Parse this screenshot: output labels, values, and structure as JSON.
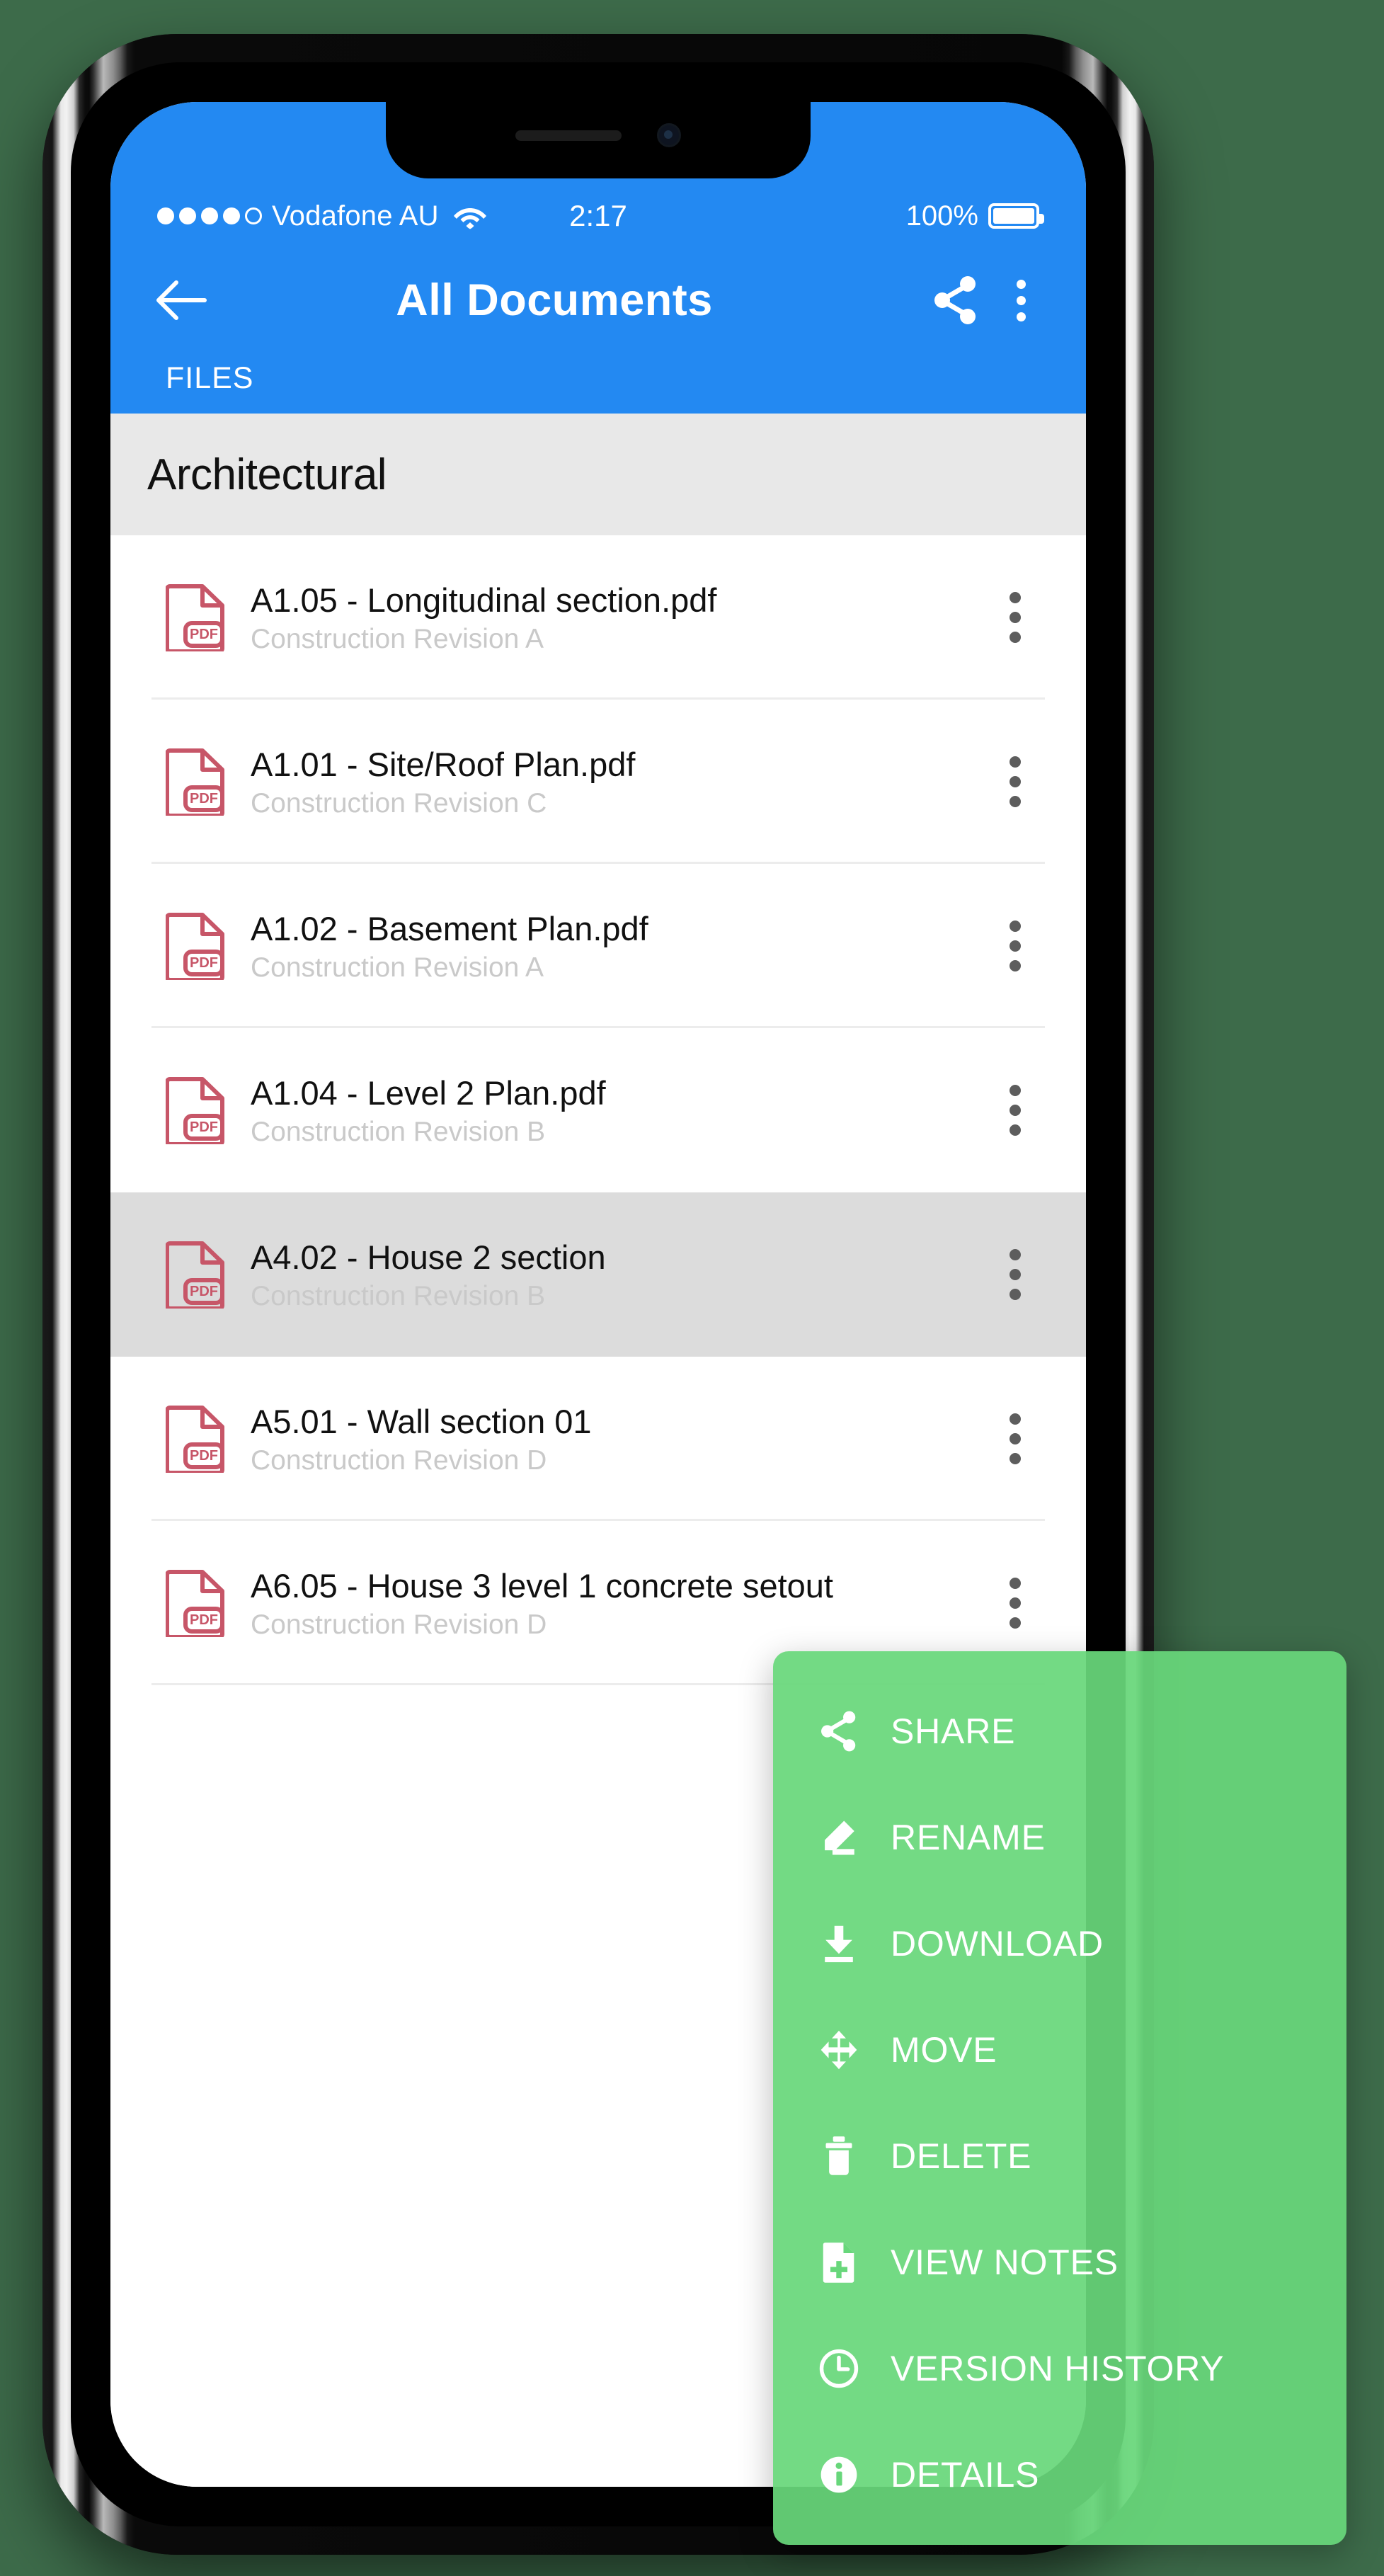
{
  "status_bar": {
    "signal_dots_filled": 4,
    "signal_dots_total": 5,
    "carrier": "Vodafone AU",
    "wifi_icon": "wifi-icon",
    "time": "2:17",
    "battery_percent": "100%",
    "battery_icon": "battery-full-icon"
  },
  "app_bar": {
    "back_icon": "back-arrow-icon",
    "title": "All Documents",
    "share_icon": "share-icon",
    "overflow_icon": "overflow-menu-icon",
    "background_color": "#2389f2"
  },
  "tabs": [
    {
      "label": "FILES",
      "active": true
    }
  ],
  "section": {
    "title": "Architectural",
    "background_color": "#e8e8e8"
  },
  "files": [
    {
      "name": "A1.05 - Longitudinal section.pdf",
      "revision": "Construction Revision A",
      "icon": "pdf-file-icon",
      "selected": false
    },
    {
      "name": "A1.01 - Site/Roof Plan.pdf",
      "revision": "Construction Revision C",
      "icon": "pdf-file-icon",
      "selected": false
    },
    {
      "name": "A1.02 - Basement Plan.pdf",
      "revision": "Construction Revision A",
      "icon": "pdf-file-icon",
      "selected": false
    },
    {
      "name": "A1.04 - Level 2 Plan.pdf",
      "revision": "Construction Revision B",
      "icon": "pdf-file-icon",
      "selected": false
    },
    {
      "name": "A4.02 - House 2 section",
      "revision": "Construction Revision B",
      "icon": "pdf-file-icon",
      "selected": true
    },
    {
      "name": "A5.01 - Wall section 01",
      "revision": "Construction Revision D",
      "icon": "pdf-file-icon",
      "selected": false
    },
    {
      "name": "A6.05 - House 3 level 1 concrete setout",
      "revision": "Construction Revision D",
      "icon": "pdf-file-icon",
      "selected": false
    }
  ],
  "context_menu": {
    "background_color": "#68d77b",
    "items": [
      {
        "label": "SHARE",
        "icon": "share-icon"
      },
      {
        "label": "RENAME",
        "icon": "pencil-icon"
      },
      {
        "label": "DOWNLOAD",
        "icon": "download-icon"
      },
      {
        "label": "MOVE",
        "icon": "move-arrows-icon"
      },
      {
        "label": "DELETE",
        "icon": "trash-icon"
      },
      {
        "label": "VIEW NOTES",
        "icon": "note-add-icon"
      },
      {
        "label": "VERSION HISTORY",
        "icon": "clock-icon"
      },
      {
        "label": "DETAILS",
        "icon": "info-icon"
      }
    ]
  },
  "theme": {
    "accent_blue": "#2389f2",
    "menu_green": "#68d77b",
    "pdf_red": "#c75668",
    "backdrop_green": "#3d6b4a",
    "selected_row": "#dcdcdc"
  }
}
